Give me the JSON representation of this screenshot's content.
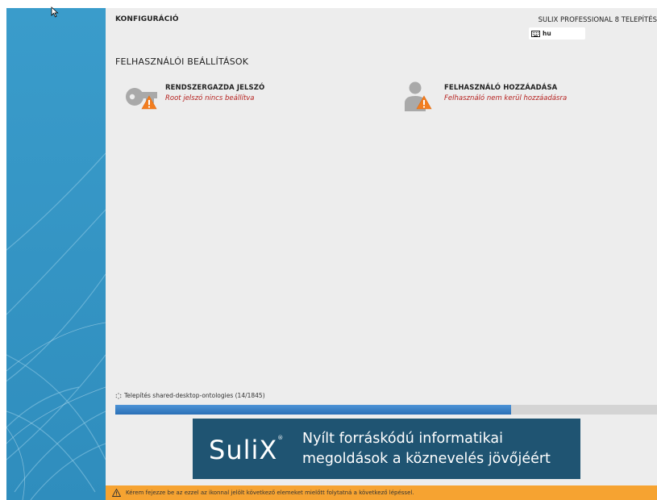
{
  "header": {
    "title": "KONFIGURÁCIÓ",
    "product": "SULIX PROFESSIONAL 8 TELEPÍTÉS",
    "keyboard_layout": "hu"
  },
  "section": {
    "title": "FELHASZNÁLÓI BEÁLLÍTÁSOK"
  },
  "spokes": [
    {
      "title": "RENDSZERGAZDA JELSZÓ",
      "status": "Root jelszó nincs beállítva",
      "icon": "key-icon"
    },
    {
      "title": "FELHASZNÁLÓ HOZZÁADÁSA",
      "status": "Felhasználó nem kerül hozzáadásra",
      "icon": "user-icon"
    }
  ],
  "progress": {
    "label": "Telepítés shared-desktop-ontologies (14/1845)",
    "fraction": 0.73
  },
  "banner": {
    "logo": "SuliX",
    "line1": "Nyílt forráskódú informatikai",
    "line2": "megoldások a köznevelés jövőjéért"
  },
  "warning": {
    "text": "Kérem fejezze be az ezzel az ikonnal jelölt következő elemeket mielőtt folytatná a következő lépéssel."
  },
  "colors": {
    "sidebar": "#3596c4",
    "warning_bar": "#f6a331",
    "status_red": "#b5201e",
    "progress_fill": "#3a80c6",
    "banner_bg": "#1f5472"
  }
}
